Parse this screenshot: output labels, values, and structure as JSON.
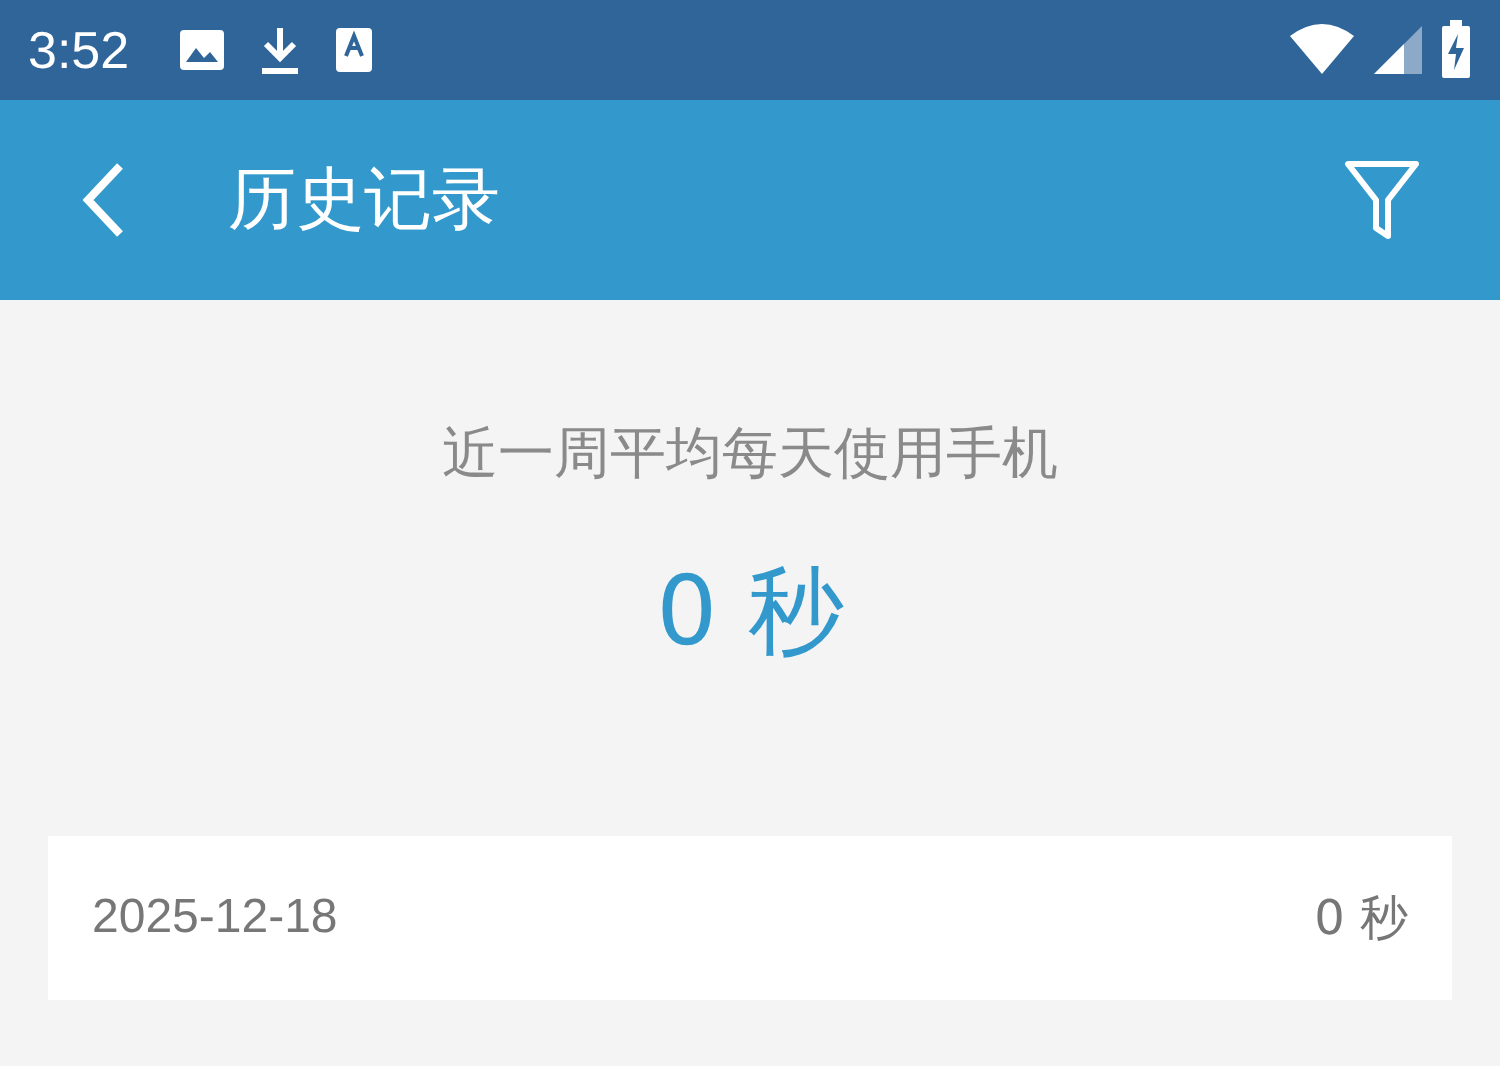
{
  "status_bar": {
    "time": "3:52"
  },
  "app_bar": {
    "title": "历史记录"
  },
  "summary": {
    "label": "近一周平均每天使用手机",
    "value": "0 秒"
  },
  "records": [
    {
      "date": "2025-12-18",
      "duration": "0 秒"
    }
  ]
}
